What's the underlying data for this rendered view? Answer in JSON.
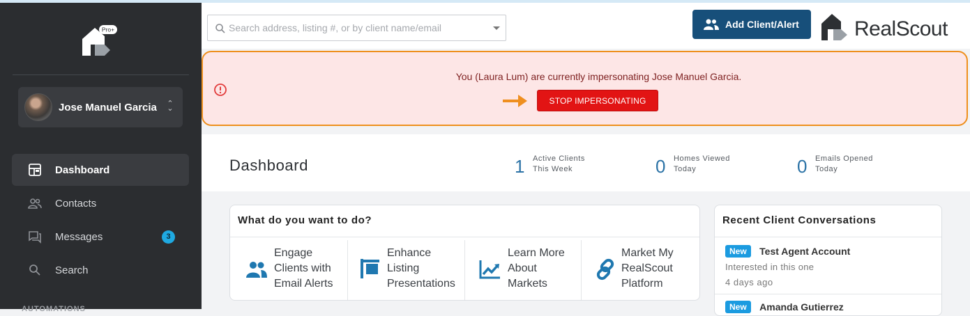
{
  "sidebar": {
    "logo_badge": "Pro+",
    "user_name": "Jose Manuel Garcia",
    "items": [
      {
        "label": "Dashboard"
      },
      {
        "label": "Contacts"
      },
      {
        "label": "Messages",
        "badge": "3"
      },
      {
        "label": "Search"
      }
    ],
    "section_label": "AUTOMATIONS"
  },
  "header": {
    "search_placeholder": "Search address, listing #, or by client name/email",
    "add_button_label": "Add Client/Alert",
    "brand_name": "RealScout"
  },
  "banner": {
    "message": "You (Laura Lum) are currently impersonating Jose Manuel Garcia.",
    "stop_button_label": "STOP IMPERSONATING"
  },
  "dashboard": {
    "title": "Dashboard",
    "stats": [
      {
        "value": "1",
        "line1": "Active Clients",
        "line2": "This Week"
      },
      {
        "value": "0",
        "line1": "Homes Viewed",
        "line2": "Today"
      },
      {
        "value": "0",
        "line1": "Emails Opened",
        "line2": "Today"
      }
    ]
  },
  "actions_card": {
    "title": "What do you want to do?",
    "items": [
      {
        "line1": "Engage",
        "line2": "Clients with",
        "line3": "Email Alerts",
        "icon": "people-icon"
      },
      {
        "line1": "Enhance",
        "line2": "Listing",
        "line3": "Presentations",
        "icon": "sign-icon"
      },
      {
        "line1": "Learn More",
        "line2": "About",
        "line3": "Markets",
        "icon": "trend-chart-icon"
      },
      {
        "line1": "Market My",
        "line2": "RealScout",
        "line3": "Platform",
        "icon": "link-icon"
      }
    ]
  },
  "conversations_card": {
    "title": "Recent Client Conversations",
    "items": [
      {
        "badge": "New",
        "name": "Test Agent Account",
        "message": "Interested in this one",
        "time": "4 days ago"
      },
      {
        "badge": "New",
        "name": "Amanda Gutierrez"
      }
    ]
  },
  "colors": {
    "sidebar_bg": "#2b2d30",
    "primary_button": "#174f7a",
    "stop_button": "#e21414",
    "banner_bg": "#fde6e6",
    "banner_border": "#ee8f1c",
    "stat_number": "#2c73a6",
    "badge_blue": "#1b9be0"
  }
}
